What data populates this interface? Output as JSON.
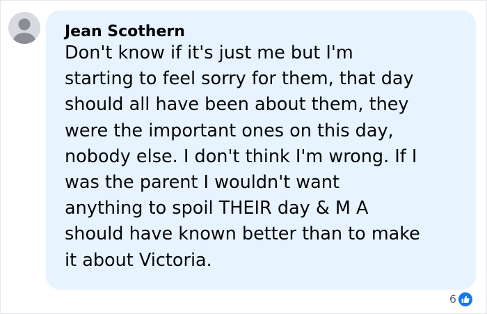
{
  "comment": {
    "author": "Jean Scothern",
    "lines": [
      "Don't know if it's just me but I'm",
      "starting to feel sorry for them, that day",
      "should all have been about them, they",
      "were the important ones on this day,",
      "nobody else. I don't think I'm wrong. If I",
      "was the parent I wouldn't want",
      "anything to spoil THEIR day & M A",
      "should have known better than to make",
      "it about Victoria."
    ],
    "reactions": {
      "count": "6",
      "icon": "like-icon"
    }
  },
  "colors": {
    "bubble": "#e7f3ff",
    "text": "#050505",
    "muted": "#65676b",
    "like": "#1877f2",
    "avatar": "#d8dadf",
    "avatar_silhouette": "#8a8d91"
  }
}
